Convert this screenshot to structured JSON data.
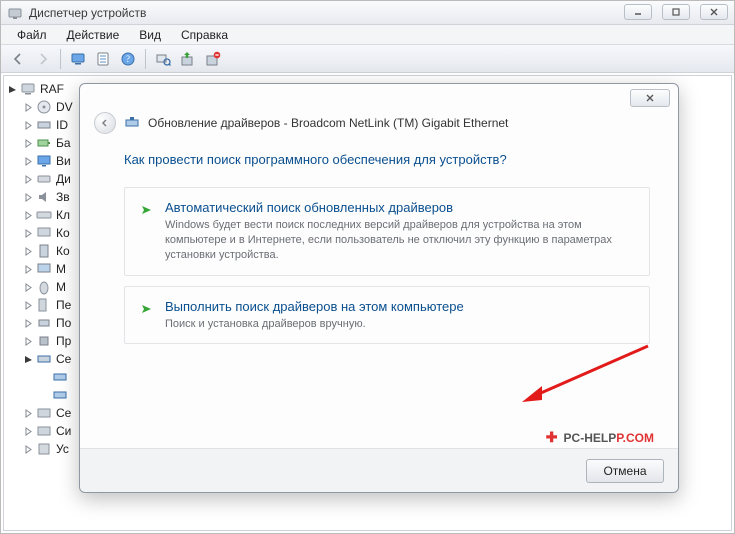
{
  "window": {
    "title": "Диспетчер устройств"
  },
  "menubar": {
    "file": "Файл",
    "action": "Действие",
    "view": "Вид",
    "help": "Справка"
  },
  "tree": {
    "root": "RAF",
    "items": [
      {
        "label": "DV"
      },
      {
        "label": "ID"
      },
      {
        "label": "Ба"
      },
      {
        "label": "Ви"
      },
      {
        "label": "Ди"
      },
      {
        "label": "Зв"
      },
      {
        "label": "Кл"
      },
      {
        "label": "Ко"
      },
      {
        "label": "Ко"
      },
      {
        "label": "М"
      },
      {
        "label": "М"
      },
      {
        "label": "Пе"
      },
      {
        "label": "По"
      },
      {
        "label": "Пр"
      },
      {
        "label": "Се"
      },
      {
        "label": "Се"
      },
      {
        "label": "Си"
      },
      {
        "label": "Ус"
      }
    ]
  },
  "dialog": {
    "title": "Обновление драйверов - Broadcom NetLink (TM) Gigabit Ethernet",
    "question": "Как провести поиск программного обеспечения для устройств?",
    "option1": {
      "title": "Автоматический поиск обновленных драйверов",
      "desc": "Windows будет вести поиск последних версий драйверов для устройства на этом компьютере и в Интернете, если пользователь не отключил эту функцию в параметрах установки устройства."
    },
    "option2": {
      "title": "Выполнить поиск драйверов на этом компьютере",
      "desc": "Поиск и установка драйверов вручную."
    },
    "cancel": "Отмена"
  },
  "watermark": {
    "a": "PC-HELP",
    "b": "P.COM"
  }
}
